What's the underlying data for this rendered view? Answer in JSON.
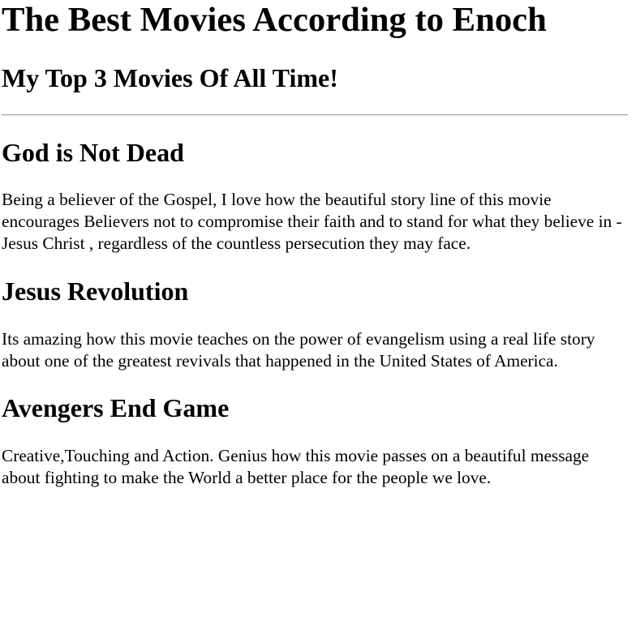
{
  "title": "The Best Movies According to Enoch",
  "subtitle": "My Top 3 Movies Of All Time!",
  "movies": [
    {
      "title": "God is Not Dead",
      "description": "Being a believer of the Gospel, I love how the beautiful story line of this movie encourages Believers not to compromise their faith and to stand for what they believe in -Jesus Christ , regardless of the countless persecution they may face."
    },
    {
      "title": "Jesus Revolution",
      "description": "Its amazing how this movie teaches on the power of evangelism using a real life story about one of the greatest revivals that happened in the United States of America."
    },
    {
      "title": "Avengers End Game",
      "description": "Creative,Touching and Action. Genius how this movie passes on a beautiful message about fighting to make the World a better place for the people we love."
    }
  ]
}
